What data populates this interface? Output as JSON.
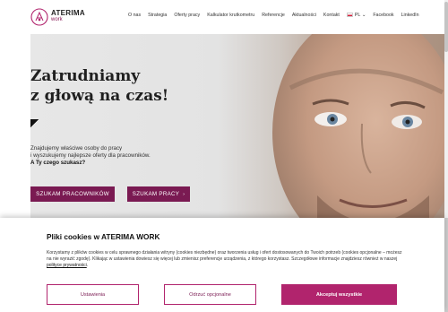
{
  "brand": {
    "name": "ATERIMA",
    "sub": "work"
  },
  "nav": {
    "items": [
      "O nas",
      "Strategia",
      "Oferty pracy",
      "Kalkulator krutkometru",
      "Referencje",
      "Aktualności",
      "Kontakt"
    ],
    "language": "PL",
    "language_chevron": "⌄",
    "social": [
      "Facebook",
      "LinkedIn"
    ]
  },
  "hero": {
    "title_line1": "Zatrudniamy",
    "title_line2": "z głową na czas!",
    "desc_line1": "Znajdujemy właściwe osoby do pracy",
    "desc_line2": "i wyszukujemy najlepsze oferty dla pracowników.",
    "desc_line3": "A Ty czego szukasz?",
    "btn_employees": "SZUKAM PRACOWNIKÓW",
    "btn_job": "SZUKAM PRACY",
    "btn_job_chevron": "›"
  },
  "cookie": {
    "title": "Pliki cookies w ATERIMA WORK",
    "text": "Korzystamy z plików cookies w celu sprawnego działania witryny (cookies niezbędne) oraz tworzenia usług i ofert dostosowanych do Twoich potrzeb (cookies opcjonalne – możesz na nie wyrazić zgodę). Klikając w ustawienia dowiesz się więcej lub zmienisz preferencje urządzenia, z którego korzystasz. Szczegółowe informacje znajdziesz również w naszej ",
    "link": "polityce prywatności",
    "text_end": ".",
    "btn_settings": "Ustawienia",
    "btn_reject": "Odrzuć opcjonalne",
    "btn_accept": "Akceptuj wszystkie"
  },
  "colors": {
    "accent": "#b1246d",
    "hero_button": "#7a1a52"
  },
  "icons": {
    "logo": "aterima-logo-icon",
    "arrow": "arrow-corner-icon"
  }
}
